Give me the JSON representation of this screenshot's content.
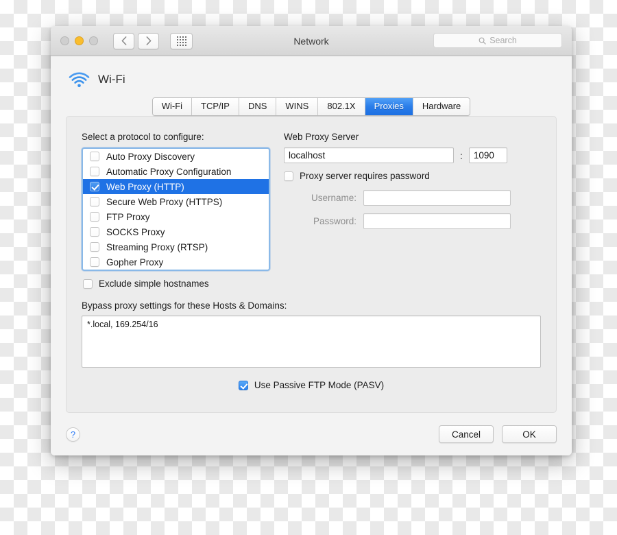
{
  "window": {
    "title": "Network",
    "traffic_lights": [
      {
        "name": "close",
        "state": "inactive"
      },
      {
        "name": "minimize",
        "state": "yellow"
      },
      {
        "name": "zoom",
        "state": "inactive"
      }
    ],
    "nav": {
      "back": "‹",
      "forward": "›",
      "grid": "show-all-grid-icon"
    },
    "search": {
      "placeholder": "Search",
      "value": ""
    }
  },
  "interface": {
    "icon": "wifi-icon",
    "name": "Wi-Fi"
  },
  "tabs": [
    {
      "label": "Wi-Fi",
      "selected": false
    },
    {
      "label": "TCP/IP",
      "selected": false
    },
    {
      "label": "DNS",
      "selected": false
    },
    {
      "label": "WINS",
      "selected": false
    },
    {
      "label": "802.1X",
      "selected": false
    },
    {
      "label": "Proxies",
      "selected": true
    },
    {
      "label": "Hardware",
      "selected": false
    }
  ],
  "protocols": {
    "label": "Select a protocol to configure:",
    "items": [
      {
        "label": "Auto Proxy Discovery",
        "checked": false,
        "selected": false
      },
      {
        "label": "Automatic Proxy Configuration",
        "checked": false,
        "selected": false
      },
      {
        "label": "Web Proxy (HTTP)",
        "checked": true,
        "selected": true
      },
      {
        "label": "Secure Web Proxy (HTTPS)",
        "checked": false,
        "selected": false
      },
      {
        "label": "FTP Proxy",
        "checked": false,
        "selected": false
      },
      {
        "label": "SOCKS Proxy",
        "checked": false,
        "selected": false
      },
      {
        "label": "Streaming Proxy (RTSP)",
        "checked": false,
        "selected": false
      },
      {
        "label": "Gopher Proxy",
        "checked": false,
        "selected": false
      }
    ]
  },
  "exclude_simple_hostnames": {
    "label": "Exclude simple hostnames",
    "checked": false
  },
  "proxy_server": {
    "title": "Web Proxy Server",
    "host": "localhost",
    "host_placeholder": "",
    "separator": ":",
    "port": "1090",
    "port_placeholder": "",
    "requires_password": {
      "label": "Proxy server requires password",
      "checked": false
    },
    "username": {
      "label": "Username:",
      "value": "",
      "enabled": false
    },
    "password": {
      "label": "Password:",
      "value": "",
      "enabled": false
    }
  },
  "bypass": {
    "label": "Bypass proxy settings for these Hosts & Domains:",
    "value": "*.local, 169.254/16"
  },
  "passive_ftp": {
    "label": "Use Passive FTP Mode (PASV)",
    "checked": true
  },
  "footer": {
    "help": "?",
    "cancel_label": "Cancel",
    "ok_label": "OK"
  },
  "colors": {
    "accent_blue": "#1f72e5",
    "tab_selected_blue": "#2a7de9",
    "wifi_icon_blue": "#3b92ec",
    "minimize_yellow": "#f9bd2e",
    "help_blue": "#2f7df5"
  }
}
